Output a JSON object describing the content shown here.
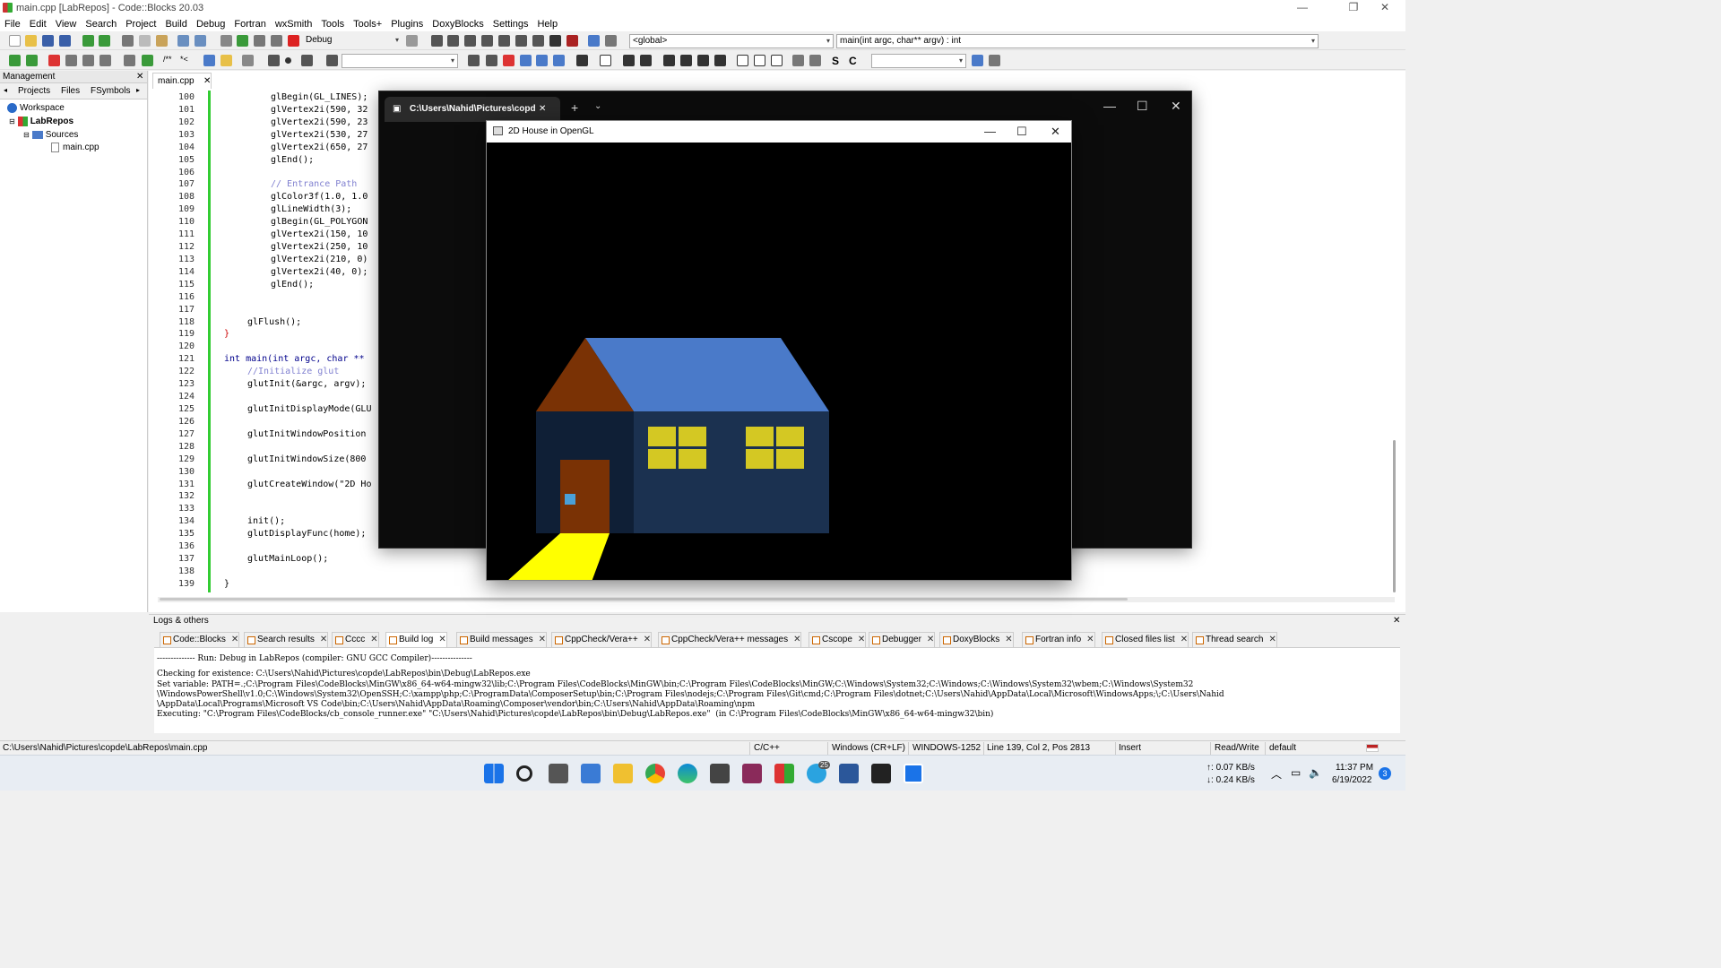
{
  "window": {
    "title": "main.cpp [LabRepos] - Code::Blocks 20.03"
  },
  "menu": [
    "File",
    "Edit",
    "View",
    "Search",
    "Project",
    "Build",
    "Debug",
    "Fortran",
    "wxSmith",
    "Tools",
    "Tools+",
    "Plugins",
    "DoxyBlocks",
    "Settings",
    "Help"
  ],
  "toolbar": {
    "build_target": "Debug",
    "scope": "<global>",
    "function": "main(int argc, char** argv) : int"
  },
  "management": {
    "title": "Management",
    "tabs": [
      "Projects",
      "Files",
      "FSymbols"
    ],
    "tree": {
      "workspace": "Workspace",
      "project": "LabRepos",
      "folder": "Sources",
      "file": "main.cpp"
    }
  },
  "editor": {
    "file_tab": "main.cpp",
    "line_numbers": [
      "100",
      "101",
      "102",
      "103",
      "104",
      "105",
      "106",
      "107",
      "108",
      "109",
      "110",
      "111",
      "112",
      "113",
      "114",
      "115",
      "116",
      "117",
      "118",
      "119",
      "120",
      "121",
      "122",
      "123",
      "124",
      "125",
      "126",
      "127",
      "128",
      "129",
      "130",
      "131",
      "132",
      "133",
      "134",
      "135",
      "136",
      "137",
      "138",
      "139"
    ]
  },
  "logs": {
    "title": "Logs & others",
    "tabs": [
      "Code::Blocks",
      "Search results",
      "Cccc",
      "Build log",
      "Build messages",
      "CppCheck/Vera++",
      "CppCheck/Vera++ messages",
      "Cscope",
      "Debugger",
      "DoxyBlocks",
      "Fortran info",
      "Closed files list",
      "Thread search"
    ],
    "lines": [
      "-------------- Run: Debug in LabRepos (compiler: GNU GCC Compiler)---------------",
      "Checking for existence: C:\\Users\\Nahid\\Pictures\\copde\\LabRepos\\bin\\Debug\\LabRepos.exe",
      "Set variable: PATH=.;C:\\Program Files\\CodeBlocks\\MinGW\\x86_64-w64-mingw32\\lib;C:\\Program Files\\CodeBlocks\\MinGW\\bin;C:\\Program Files\\CodeBlocks\\MinGW;C:\\Windows\\System32;C:\\Windows;C:\\Windows\\System32\\wbem;C:\\Windows\\System32",
      "\\WindowsPowerShell\\v1.0;C:\\Windows\\System32\\OpenSSH;C:\\xampp\\php;C:\\ProgramData\\ComposerSetup\\bin;C:\\Program Files\\nodejs;C:\\Program Files\\Git\\cmd;C:\\Program Files\\dotnet;C:\\Users\\Nahid\\AppData\\Local\\Microsoft\\WindowsApps;\\;C:\\Users\\Nahid",
      "\\AppData\\Local\\Programs\\Microsoft VS Code\\bin;C:\\Users\\Nahid\\AppData\\Roaming\\Composer\\vendor\\bin;C:\\Users\\Nahid\\AppData\\Roaming\\npm",
      "Executing: \"C:\\Program Files\\CodeBlocks/cb_console_runner.exe\" \"C:\\Users\\Nahid\\Pictures\\copde\\LabRepos\\bin\\Debug\\LabRepos.exe\"  (in C:\\Program Files\\CodeBlocks\\MinGW\\x86_64-w64-mingw32\\bin)"
    ]
  },
  "status": {
    "path": "C:\\Users\\Nahid\\Pictures\\copde\\LabRepos\\main.cpp",
    "lang": "C/C++",
    "eol": "Windows (CR+LF)",
    "enc": "WINDOWS-1252",
    "pos": "Line 139, Col 2, Pos 2813",
    "mode": "Insert",
    "rw": "Read/Write",
    "profile": "default"
  },
  "terminal": {
    "tab_title": "C:\\Users\\Nahid\\Pictures\\copd"
  },
  "glwindow": {
    "title": "2D House in OpenGL",
    "colors": {
      "roof": "#4a7ac9",
      "gable": "#7a3205",
      "front": "#0f1f36",
      "side": "#1b3150",
      "door": "#7a3205",
      "knob": "#4aa0d8",
      "window": "#d4c823",
      "path": "#ffff00"
    }
  },
  "taskbar": {
    "net_up": "0.07 KB/s",
    "net_down": "0.24 KB/s",
    "time": "11:37 PM",
    "date": "6/19/2022",
    "telegram_badge": "25",
    "notif": "3"
  }
}
